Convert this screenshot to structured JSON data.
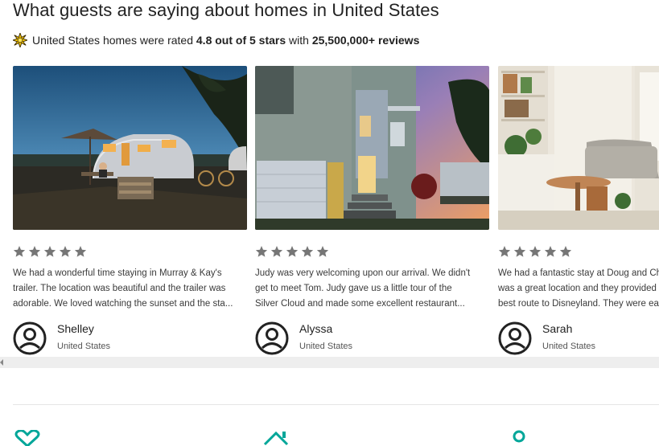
{
  "header": {
    "title": "What guests are saying about homes in United States",
    "rating_prefix": "United States homes were rated ",
    "rating_score": "4.8 out of 5 stars",
    "rating_mid": " with ",
    "rating_count": "25,500,000+ reviews"
  },
  "colors": {
    "accent": "#00a699",
    "star": "#767676",
    "text": "#222222"
  },
  "reviews": [
    {
      "photo": "vintage airstream trailer at dusk",
      "stars": 5,
      "lines": [
        "We had a wonderful time staying in Murray & Kay's",
        "trailer. The location was beautiful and the trailer was",
        "adorable. We loved watching the sunset and the sta..."
      ],
      "name": "Shelley",
      "location": "United States"
    },
    {
      "photo": "modern two-story house at sunset",
      "stars": 5,
      "lines": [
        "Judy was very welcoming upon our arrival. We didn't",
        "get to meet Tom. Judy gave us a little tour of the",
        "Silver Cloud and made some excellent restaurant..."
      ],
      "name": "Alyssa",
      "location": "United States"
    },
    {
      "photo": "bright living room with plants",
      "stars": 5,
      "lines": [
        "We had a fantastic stay at Doug and Chr",
        "was a great location and they provided u",
        "best route to Disneyland. They were easy"
      ],
      "name": "Sarah",
      "location": "United States"
    }
  ],
  "icons": [
    "heart-icon",
    "home-icon",
    "user-icon"
  ]
}
